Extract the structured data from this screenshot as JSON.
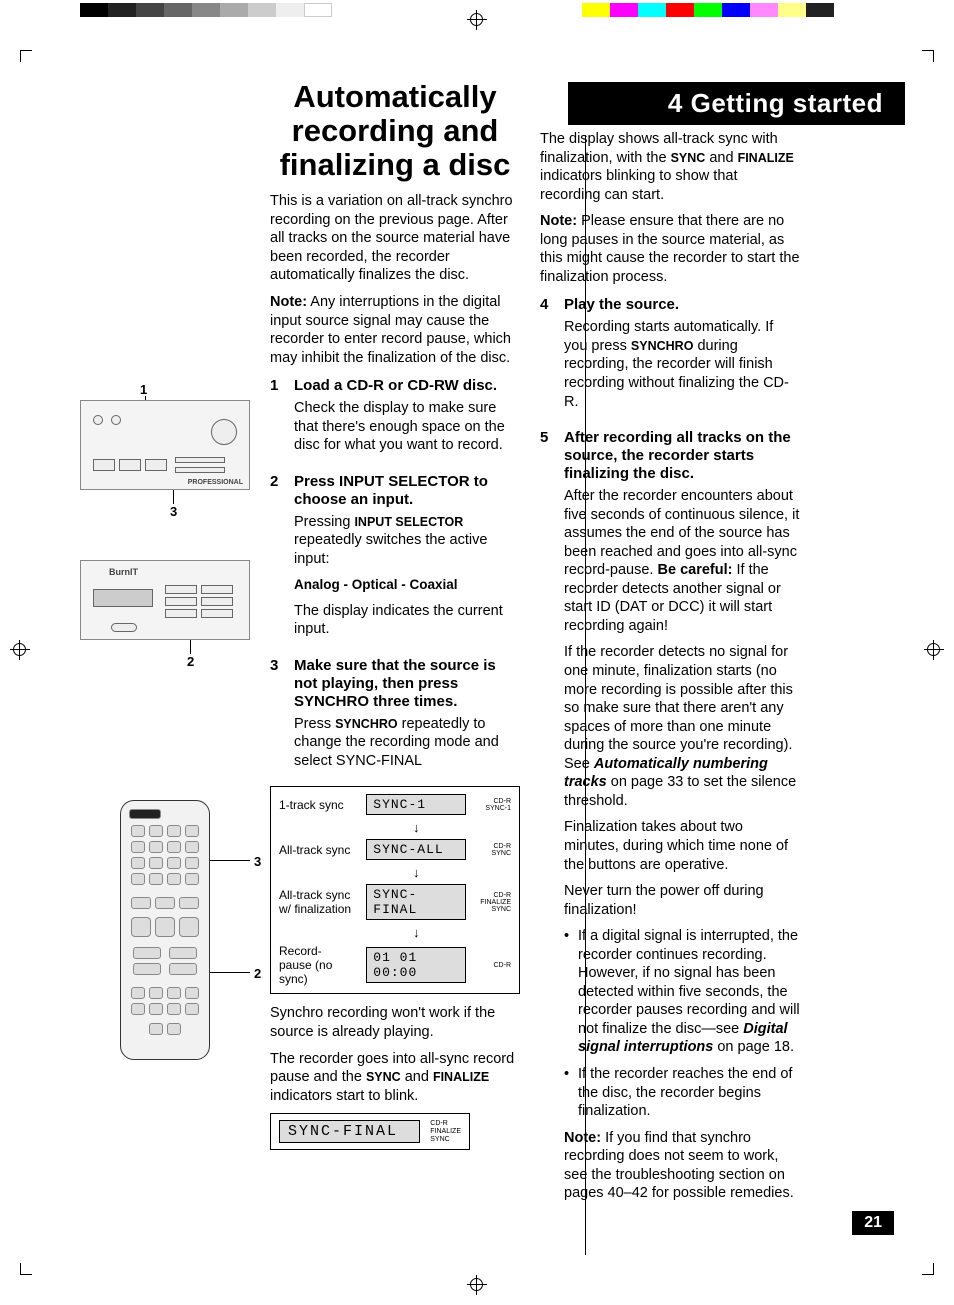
{
  "chapter": {
    "number": "4",
    "title": "Getting started",
    "banner": "4 Getting started"
  },
  "page_number": "21",
  "heading": "Automatically recording and finalizing a disc",
  "intro": "This is a variation on all-track synchro recording on the previous page. After all tracks on the source material have been recorded, the recorder automatically finalizes the disc.",
  "intro_note_label": "Note:",
  "intro_note": " Any interruptions in the digital input source signal may cause the recorder to enter record pause, which may inhibit the finalization of the disc.",
  "steps": {
    "s1": {
      "num": "1",
      "head": "Load a CD-R or CD-RW disc.",
      "body": "Check the display to make sure that there's enough space on the disc for what you want to record."
    },
    "s2": {
      "num": "2",
      "head": "Press INPUT SELECTOR to choose an input.",
      "body_a": "Pressing ",
      "body_kw": "INPUT SELECTOR",
      "body_b": " repeatedly switches the active input:",
      "options": "Analog - Optical -  Coaxial",
      "body_c": "The display indicates the current input."
    },
    "s3": {
      "num": "3",
      "head": "Make sure that the source is not playing, then press SYNCHRO three times.",
      "body_a": "Press ",
      "body_kw": "SYNCHRO",
      "body_b": " repeatedly to change the recording mode and select SYNC-FINAL"
    },
    "s4": {
      "num": "4",
      "head": "Play the source.",
      "body_a": "Recording starts automatically. If you press ",
      "body_kw": "SYNCHRO",
      "body_b": " during recording, the recorder will finish recording without finalizing the CD-R."
    },
    "s5": {
      "num": "5",
      "head": "After recording all tracks on the source, the recorder starts finalizing the disc.",
      "p1a": "After the recorder encounters about five seconds of continuous silence, it assumes the end of the source has been reached and goes into all-sync record-pause. ",
      "p1_kw": "Be careful:",
      "p1b": " If the recorder detects another signal or start ID (DAT or DCC) it will start recording again!",
      "p2a": "If the recorder detects no signal for one minute, finalization starts (no more recording is possible after this so make sure that there aren't any spaces of more than one minute during the source you're recording). See ",
      "p2_kw": "Automatically numbering tracks",
      "p2b": " on page 33 to set the silence threshold.",
      "p3": "Finalization takes about two minutes, during which time none of the buttons are operative.",
      "p4": "Never turn the power off during finalization!",
      "bul1a": "If a digital signal is interrupted, the recorder continues recording. However, if no signal has been detected within five seconds, the recorder pauses recording and will not finalize the disc—see ",
      "bul1_kw": "Digital signal interruptions",
      "bul1b": " on page 18.",
      "bul2": "If the recorder reaches the end of the disc, the recorder begins finalization.",
      "note_label": "Note:",
      "note": " If you find that synchro recording does not seem to work, see the troubleshooting section on pages 40–42 for possible remedies."
    }
  },
  "sync_table": {
    "r1": {
      "label": "1-track sync",
      "display": "SYNC-1",
      "ind1": "CD-R",
      "ind2": "SYNC-1"
    },
    "r2": {
      "label": "All-track sync",
      "display": "SYNC-ALL",
      "ind1": "CD-R",
      "ind2": "SYNC"
    },
    "r3": {
      "label": "All-track sync w/ finalization",
      "display": "SYNC-FINAL",
      "ind1": "CD-R",
      "ind2": "FINALIZE",
      "ind3": "SYNC"
    },
    "r4": {
      "label": "Record-pause (no sync)",
      "display": "01 01 00:00",
      "ind1": "CD-R"
    }
  },
  "post_table": {
    "p1": "Synchro recording won't work if the source is already playing.",
    "p2a": "The recorder goes into all-sync record pause and the ",
    "p2_kw1": "SYNC",
    "p2b": " and ",
    "p2_kw2": "FINALIZE",
    "p2c": " indicators start to blink."
  },
  "final_display": {
    "text": "SYNC-FINAL",
    "ind1": "CD-R",
    "ind2": "FINALIZE",
    "ind3": "SYNC"
  },
  "right_intro": {
    "p1a": "The display shows all-track sync with finalization, with the ",
    "p1_kw1": "SYNC",
    "p1b": " and ",
    "p1_kw2": "FINALIZE",
    "p1c": " indicators blinking to show that recording can start.",
    "note_label": "Note:",
    "note": " Please ensure that there are no long pauses in the source material, as this might cause the recorder to start the finalization process."
  },
  "color_bars": {
    "left": [
      "#000",
      "#222",
      "#444",
      "#666",
      "#888",
      "#aaa",
      "#ccc",
      "#eee",
      "#fff"
    ],
    "right": [
      "#ff0",
      "#f0f",
      "#0ff",
      "#f00",
      "#0f0",
      "#00f",
      "#f7f",
      "#ff8",
      "#222"
    ]
  },
  "callouts": {
    "c1": "1",
    "c2": "2",
    "c3": "3"
  },
  "illus": {
    "top_label": "PROFESSIONAL",
    "mid_label": "BurnIT"
  }
}
